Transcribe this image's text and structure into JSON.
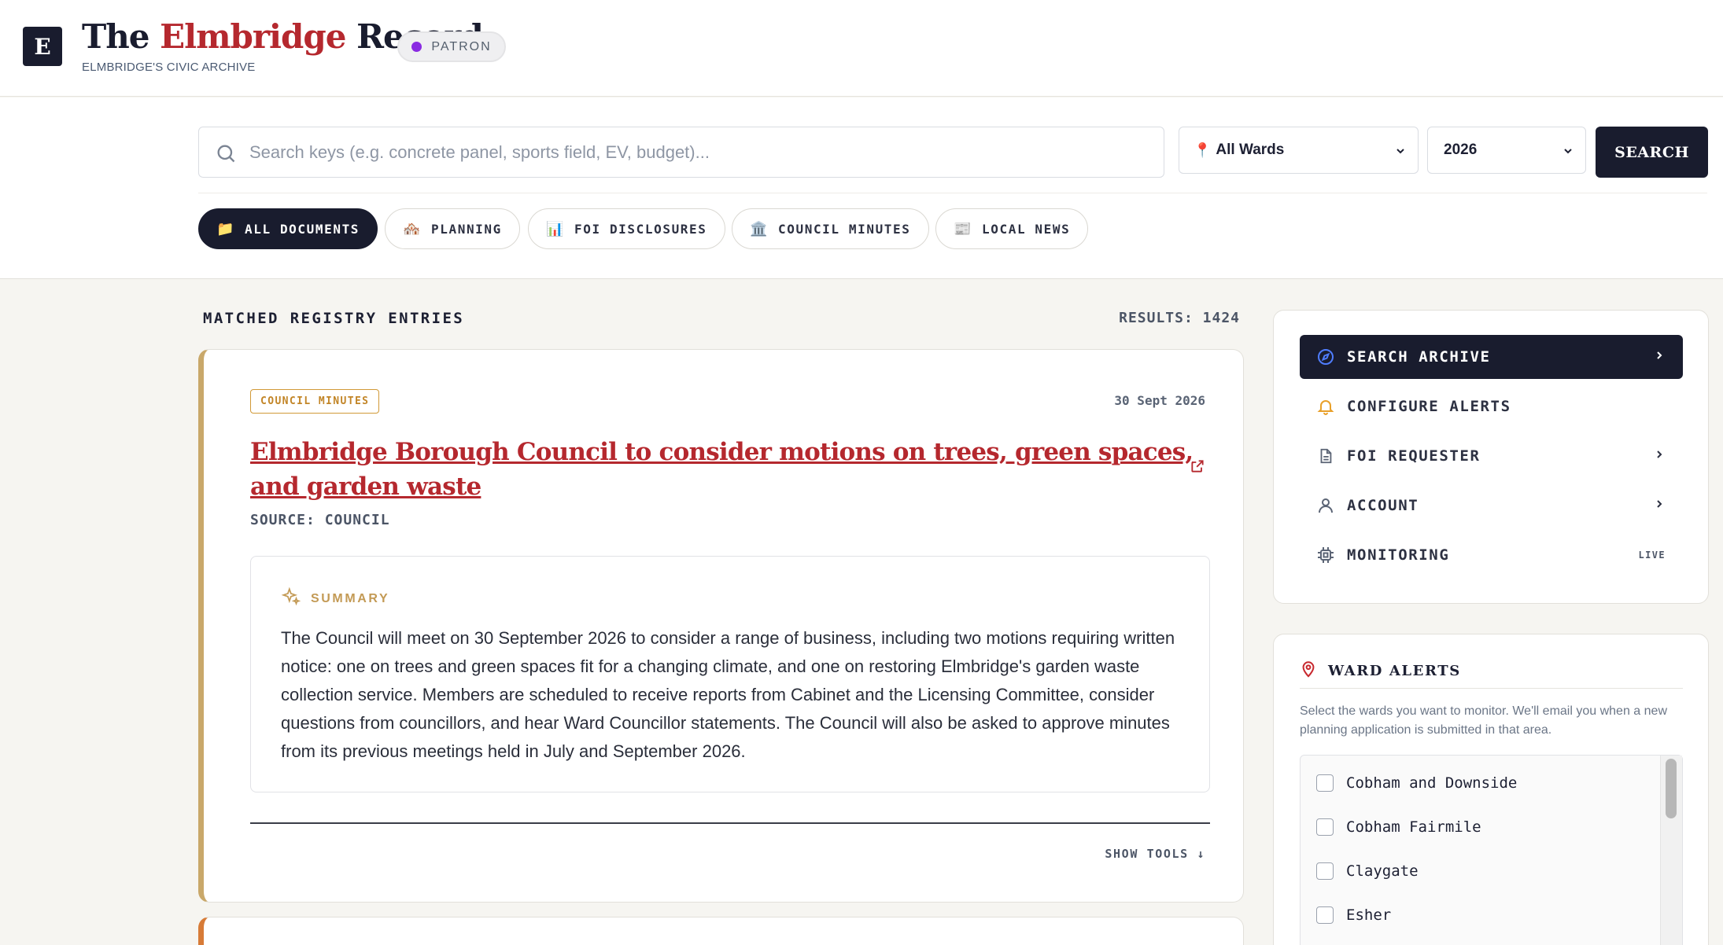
{
  "header": {
    "logo_letter": "E",
    "title_prefix": "The ",
    "title_accent": "Elmbridge",
    "title_suffix": " Record",
    "subtitle": "ELMBRIDGE'S CIVIC ARCHIVE",
    "badge": "PATRON",
    "badge_color": "#8a2be2"
  },
  "search": {
    "placeholder": "Search keys (e.g. concrete panel, sports field, EV, budget)...",
    "ward_value": "All Wards",
    "year_value": "2026",
    "button_label": "SEARCH"
  },
  "filters": [
    {
      "emoji": "📁",
      "label": "ALL DOCUMENTS",
      "active": true
    },
    {
      "emoji": "🏘️",
      "label": "PLANNING",
      "active": false
    },
    {
      "emoji": "📊",
      "label": "FOI DISCLOSURES",
      "active": false
    },
    {
      "emoji": "🏛️",
      "label": "COUNCIL MINUTES",
      "active": false
    },
    {
      "emoji": "📰",
      "label": "LOCAL NEWS",
      "active": false
    }
  ],
  "results": {
    "heading": "MATCHED REGISTRY ENTRIES",
    "count_label": "RESULTS: 1424"
  },
  "entry": {
    "tag": "COUNCIL MINUTES",
    "date": "30 Sept 2026",
    "title": "Elmbridge Borough Council to consider motions on trees, green spaces, and garden waste",
    "source": "SOURCE: COUNCIL",
    "summary_label": "SUMMARY",
    "summary": "The Council will meet on 30 September 2026 to consider a range of business, including two motions requiring written notice: one on trees and green spaces fit for a changing climate, and one on restoring Elmbridge's garden waste collection service. Members are scheduled to receive reports from Cabinet and the Licensing Committee, consider questions from councillors, and hear Ward Councillor statements. The Council will also be asked to approve minutes from its previous meetings held in July and September 2026.",
    "show_tools": "SHOW TOOLS ↓",
    "accent_color": "#c9a86a"
  },
  "sidebar": {
    "nav": [
      {
        "label": "SEARCH ARCHIVE",
        "icon": "compass-icon",
        "right": "›",
        "active": true
      },
      {
        "label": "CONFIGURE ALERTS",
        "icon": "bell-icon",
        "right": "",
        "active": false
      },
      {
        "label": "FOI REQUESTER",
        "icon": "document-icon",
        "right": "›",
        "active": false
      },
      {
        "label": "ACCOUNT",
        "icon": "user-icon",
        "right": "›",
        "active": false
      },
      {
        "label": "MONITORING",
        "icon": "chip-icon",
        "right": "LIVE",
        "active": false
      }
    ],
    "ward_alerts": {
      "title": "WARD ALERTS",
      "description": "Select the wards you want to monitor. We'll email you when a new planning application is submitted in that area.",
      "wards": [
        "Cobham and Downside",
        "Cobham Fairmile",
        "Claygate",
        "Esher"
      ]
    }
  }
}
